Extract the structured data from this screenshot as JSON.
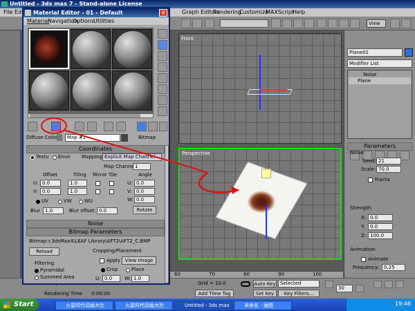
{
  "app": {
    "title": "Untitled - 3ds max 7 - Stand-alone License",
    "menu": [
      "File",
      "Edit",
      "Graph Editors",
      "Rendering",
      "Customize",
      "MAXScript",
      "Help"
    ],
    "view_dropdown": "View"
  },
  "viewports": {
    "front_label": "Front",
    "persp_label": "Perspective"
  },
  "command_panel": {
    "object_name": "Plane01",
    "modifier_list": "Modifier List",
    "stack": [
      "Noise",
      "Plane"
    ],
    "params_title": "Parameters",
    "noise_label": "Noise:",
    "seed_label": "Seed:",
    "seed_value": "21",
    "scale_label": "Scale:",
    "scale_value": "70.0",
    "fractal_label": "Fracta",
    "strength_label": "Strength:",
    "x_label": "X:",
    "x_value": "0.0",
    "y_label": "Y:",
    "y_value": "0.0",
    "z_label": "Z:",
    "z_value": "100.0",
    "animation_label": "Animation:",
    "animate_label": "Animate",
    "frequency_label": "Frequency:",
    "frequency_value": "0.25"
  },
  "material_editor": {
    "title": "Material Editor - 01 - Default",
    "menu": [
      "Material",
      "Navigation",
      "Options",
      "Utilities"
    ],
    "diffuse_label": "Diffuse Color:",
    "map_name": "Map #2",
    "map_type": "Bitmap",
    "coordinates_title": "Coordinates",
    "texture_label": "Textu",
    "environ_label": "Envir",
    "mapping_label": "Mapping:",
    "mapping_value": "Explicit Map Channel",
    "map_channel_label": "Map Channel",
    "map_channel_value": "1",
    "offset_label": "Offset",
    "tiling_label": "Tiling",
    "mirror_tile_label": "Mirror Tile",
    "angle_label": "Angle",
    "u_label": "U:",
    "v_label": "V:",
    "w_label": "W:",
    "u_offset": "0.0",
    "v_offset": "0.0",
    "u_tiling": "1.0",
    "v_tiling": "1.0",
    "u_angle": "0.0",
    "v_angle": "0.0",
    "w_angle": "0.0",
    "uv_label": "UV",
    "vw_label": "VW",
    "wu_label": "WU",
    "blur_label": "Blur",
    "blur_value": "1.0",
    "blur_offset_label": "Blur offset:",
    "blur_offset_value": "0.0",
    "rotate_label": "Rotate",
    "noise_title": "Noise",
    "bitmap_params_title": "Bitmap Parameters",
    "bitmap_path_label": "Bitmap:",
    "bitmap_path": "r.3dsMax4\\LEAF Library\\AFT2\\AFT2_C.BMP",
    "reload_label": "Reload",
    "cropping_label": "Cropping/Placement",
    "apply_label": "Apply",
    "view_image_label": "View Image",
    "filtering_label": "Filtering",
    "pyramidal_label": "Pyramidal",
    "summed_label": "Summed Area",
    "crop_label": "Crop",
    "place_label": "Place",
    "u_crop_value": "0.0",
    "w_crop_value": "1.0"
  },
  "status": {
    "object_label": "1 Object",
    "grid_label": "Grid = 10.0",
    "add_time_tag": "Add Time Tag",
    "rendering_time_label": "Rendering Time",
    "rendering_time_value": "0:00:00",
    "auto_key": "Auto Key",
    "selected": "Selected",
    "set_key": "Set Key",
    "key_filters": "Key Filters...",
    "frame_value": "30",
    "ruler_ticks": [
      "60",
      "70",
      "80",
      "90",
      "100"
    ]
  },
  "taskbar": {
    "start": "Start",
    "items": [
      "火星时代动画大社区...",
      "火星时代动画大社区...",
      "Untitled - 3ds max 7",
      "未命名 - 画图"
    ],
    "clock": "19:46"
  },
  "colors": {
    "accent_red": "#e01010",
    "viewport_active": "#18e018",
    "title_blue": "#0a246a"
  }
}
